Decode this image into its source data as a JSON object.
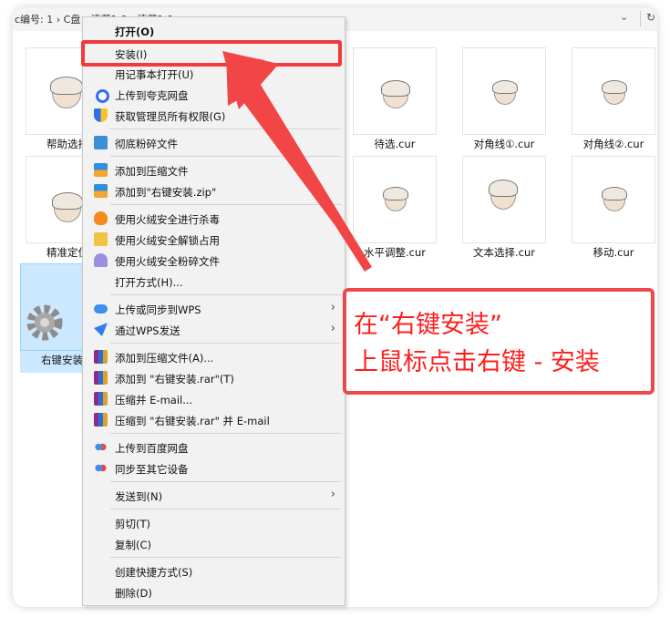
{
  "address_bar": {
    "crumb": "с编号: 1  ›  C盘  ›  清莫1.0  ›  清莫1.0",
    "dropdown_glyph": "⌄",
    "refresh_glyph": "↻"
  },
  "files": [
    {
      "label": "帮助选择"
    },
    {
      "label": "精准定位"
    },
    {
      "label": "右键安装"
    },
    {
      "label": "待选.cur"
    },
    {
      "label": "对角线①.cur"
    },
    {
      "label": "对角线②.cur"
    },
    {
      "label": "水平调整.cur"
    },
    {
      "label": "文本选择.cur"
    },
    {
      "label": "移动.cur"
    }
  ],
  "menu": {
    "items": [
      {
        "label": "打开(O)",
        "icon": "none"
      },
      {
        "label": "安装(I)",
        "icon": "none"
      },
      {
        "label": "用记事本打开(U)",
        "icon": "none"
      },
      {
        "label": "上传到夸克网盘",
        "icon": "quark-icon"
      },
      {
        "label": "获取管理员所有权限(G)",
        "icon": "shield-icon"
      },
      {
        "label": "彻底粉碎文件",
        "icon": "shredder-icon"
      },
      {
        "label": "添加到压缩文件",
        "icon": "archive-icon"
      },
      {
        "label": "添加到\"右键安装.zip\"",
        "icon": "archive-icon"
      },
      {
        "label": "使用火绒安全进行杀毒",
        "icon": "flame-icon"
      },
      {
        "label": "使用火绒安全解锁占用",
        "icon": "folder-unlock-icon"
      },
      {
        "label": "使用火绒安全粉碎文件",
        "icon": "shred-icon"
      },
      {
        "label": "打开方式(H)...",
        "icon": "none"
      },
      {
        "label": "上传或同步到WPS",
        "icon": "cloud-icon",
        "submenu": true
      },
      {
        "label": "通过WPS发送",
        "icon": "send-icon",
        "submenu": true
      },
      {
        "label": "添加到压缩文件(A)...",
        "icon": "winrar-icon"
      },
      {
        "label": "添加到 \"右键安装.rar\"(T)",
        "icon": "winrar-icon"
      },
      {
        "label": "压缩并 E-mail...",
        "icon": "winrar-icon"
      },
      {
        "label": "压缩到 \"右键安装.rar\" 并 E-mail",
        "icon": "winrar-icon"
      },
      {
        "label": "上传到百度网盘",
        "icon": "baidu-icon"
      },
      {
        "label": "同步至其它设备",
        "icon": "baidu-icon"
      },
      {
        "label": "发送到(N)",
        "icon": "none",
        "submenu": true
      },
      {
        "label": "剪切(T)",
        "icon": "none"
      },
      {
        "label": "复制(C)",
        "icon": "none"
      },
      {
        "label": "创建快捷方式(S)",
        "icon": "none"
      },
      {
        "label": "删除(D)",
        "icon": "none"
      }
    ],
    "submenu_glyph": "›"
  },
  "annotation": {
    "line1": "在“右键安装”",
    "line2": "上鼠标点击右键 - 安装",
    "color": "#ff1e1e"
  }
}
